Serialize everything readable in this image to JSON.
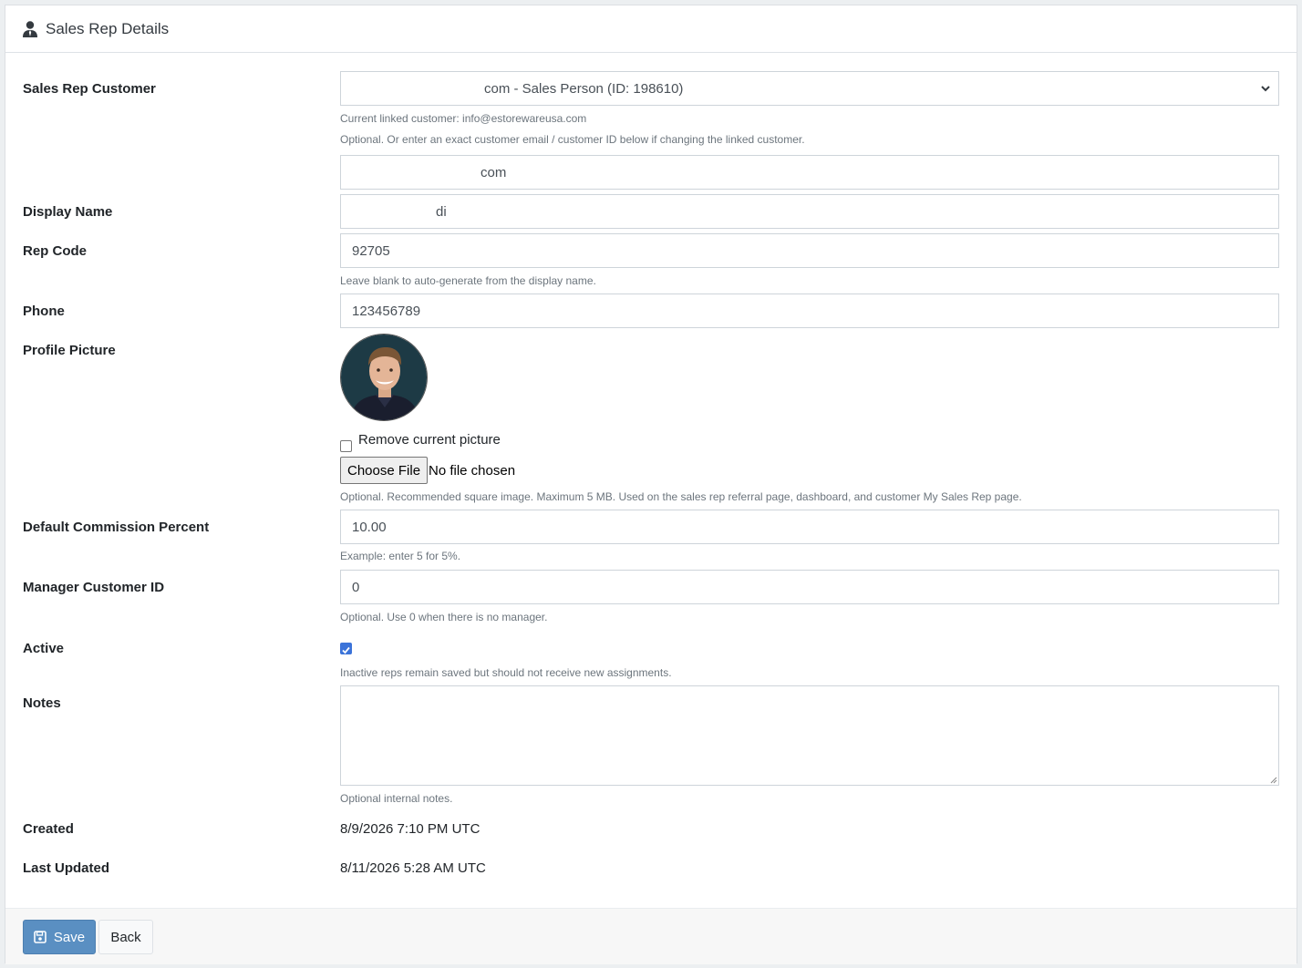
{
  "header": {
    "title": "Sales Rep Details",
    "icon": "user-icon"
  },
  "form": {
    "sales_rep_customer": {
      "label": "Sales Rep Customer",
      "selected": "com - Sales Person (ID: 198610)",
      "current_linked": "Current linked customer: info@estorewareusa.com",
      "help": "Optional. Or enter an exact customer email / customer ID below if changing the linked customer.",
      "override_value": "com"
    },
    "display_name": {
      "label": "Display Name",
      "value": "di"
    },
    "rep_code": {
      "label": "Rep Code",
      "value": "92705",
      "help": "Leave blank to auto-generate from the display name."
    },
    "phone": {
      "label": "Phone",
      "value": "123456789"
    },
    "profile_picture": {
      "label": "Profile Picture",
      "remove_label": "Remove current picture",
      "remove_checked": false,
      "choose_file": "Choose File",
      "file_status": "No file chosen",
      "help": "Optional. Recommended square image. Maximum 5 MB. Used on the sales rep referral page, dashboard, and customer My Sales Rep page."
    },
    "commission": {
      "label": "Default Commission Percent",
      "value": "10.00",
      "help": "Example: enter 5 for 5%."
    },
    "manager": {
      "label": "Manager Customer ID",
      "value": "0",
      "help": "Optional. Use 0 when there is no manager."
    },
    "active": {
      "label": "Active",
      "checked": true,
      "help": "Inactive reps remain saved but should not receive new assignments."
    },
    "notes": {
      "label": "Notes",
      "value": "",
      "help": "Optional internal notes."
    },
    "created": {
      "label": "Created",
      "value": "8/9/2026 7:10 PM UTC"
    },
    "last_updated": {
      "label": "Last Updated",
      "value": "8/11/2026 5:28 AM UTC"
    }
  },
  "footer": {
    "save_label": "Save",
    "back_label": "Back"
  },
  "colors": {
    "primary": "#5a8fc2",
    "checkbox": "#3b73d9"
  }
}
